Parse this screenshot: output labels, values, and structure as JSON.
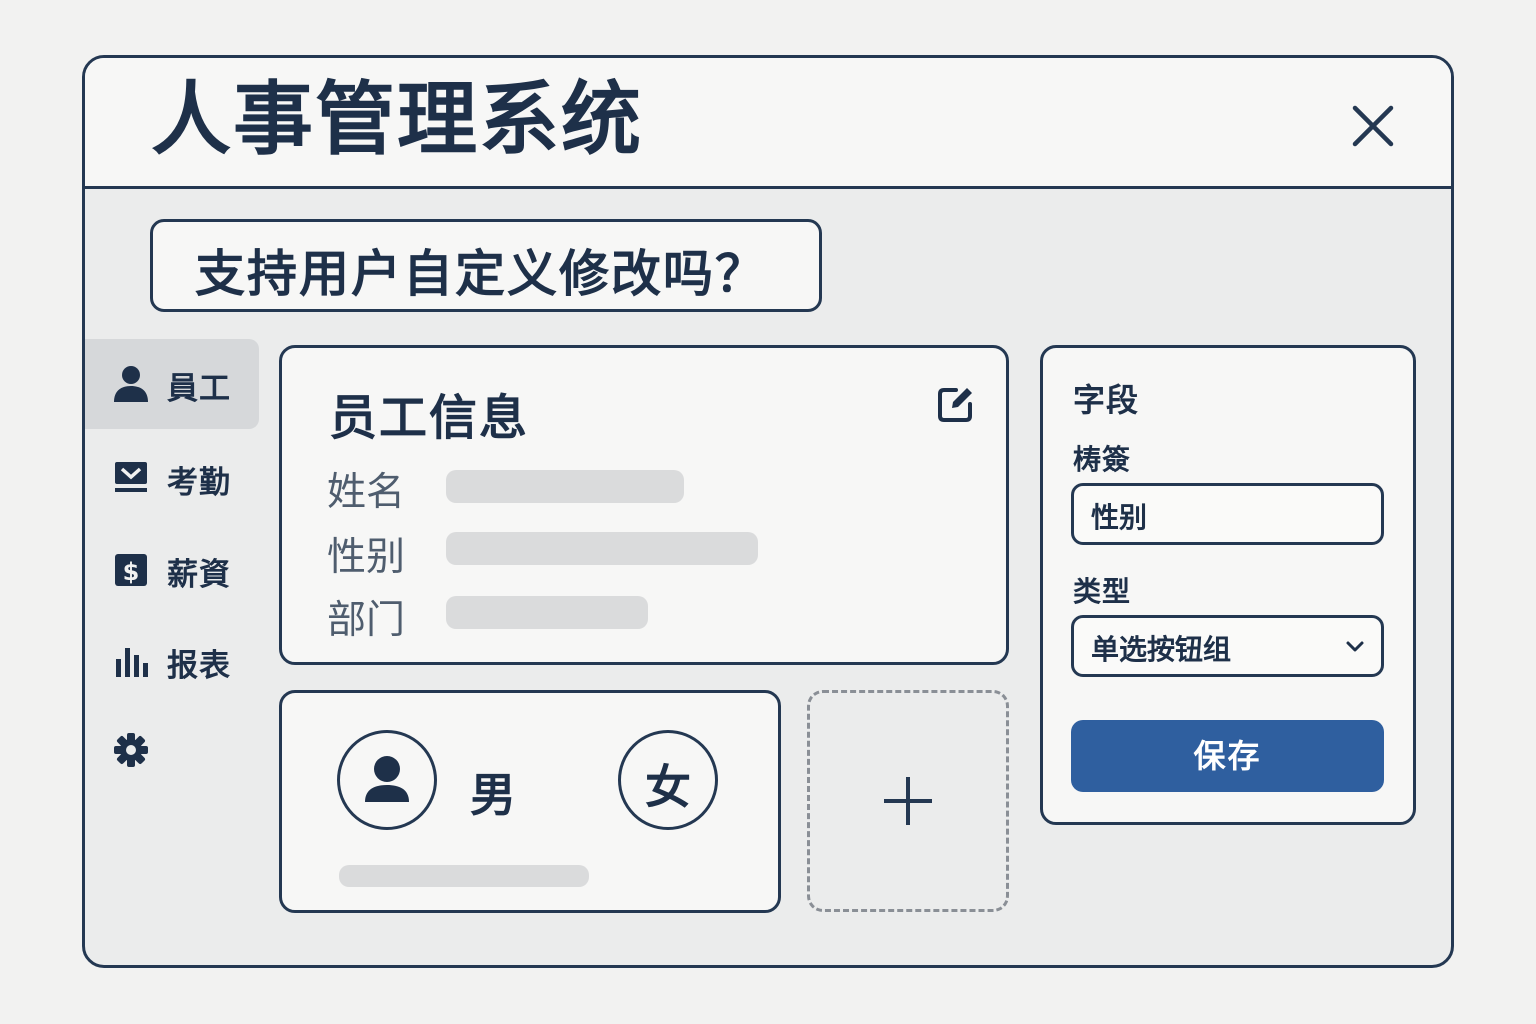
{
  "app": {
    "title": "人事管理系统"
  },
  "banner": {
    "question": "支持用户自定义修改吗？"
  },
  "sidebar": {
    "items": [
      {
        "label": "員工",
        "icon": "user-icon",
        "active": true
      },
      {
        "label": "考勤",
        "icon": "attendance-icon",
        "active": false
      },
      {
        "label": "薪資",
        "icon": "dollar-icon",
        "active": false
      },
      {
        "label": "报表",
        "icon": "bar-chart-icon",
        "active": false
      },
      {
        "label": "",
        "icon": "gear-icon",
        "active": false
      }
    ]
  },
  "employee_card": {
    "title": "员工信息",
    "fields": [
      {
        "label": "姓名"
      },
      {
        "label": "性别"
      },
      {
        "label": "部门"
      }
    ]
  },
  "gender_card": {
    "options": [
      {
        "label": "男",
        "icon": "user-icon"
      },
      {
        "label": "女"
      }
    ]
  },
  "add_card": {
    "icon": "plus-icon"
  },
  "field_panel": {
    "heading": "字段",
    "label_caption": "梼簽",
    "label_value": "性别",
    "type_caption": "类型",
    "type_value": "单选按钮组",
    "save_label": "保存"
  },
  "colors": {
    "primary": "#2f5f9f",
    "border": "#243852",
    "text": "#1e3049",
    "background": "#ebecec"
  }
}
